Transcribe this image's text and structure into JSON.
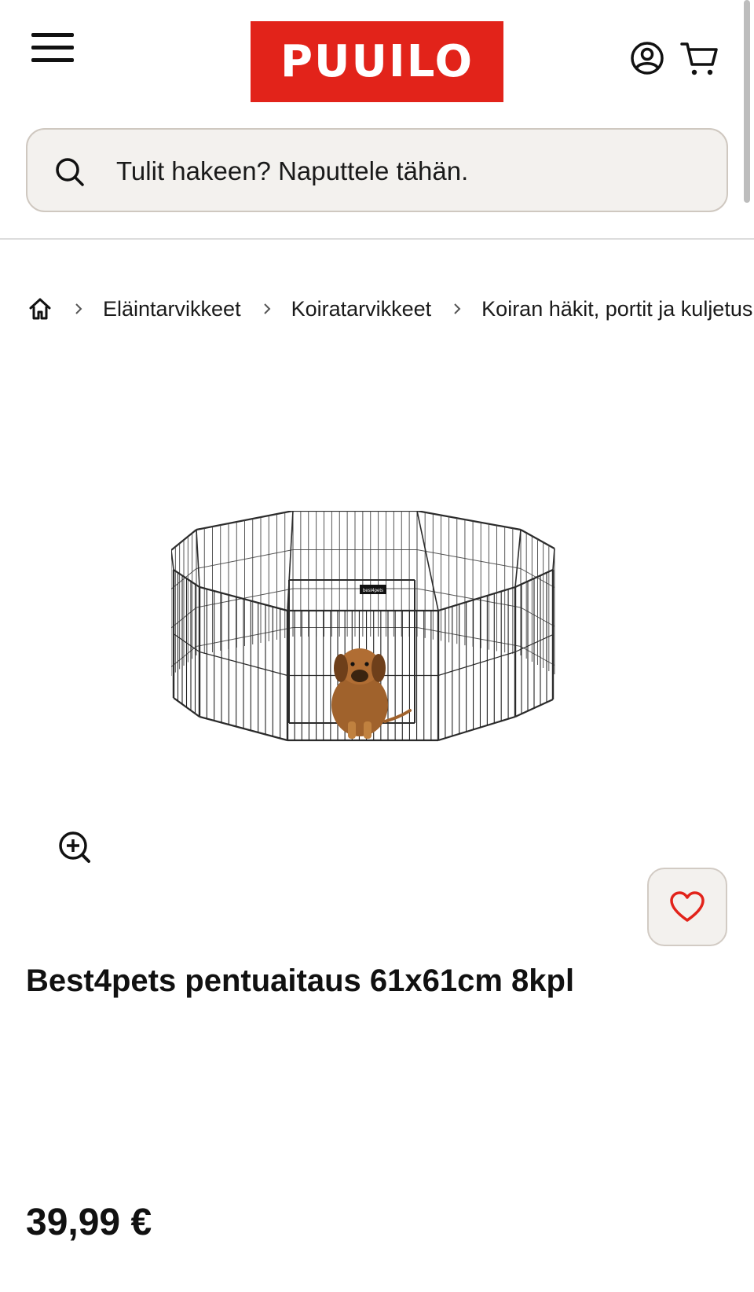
{
  "header": {
    "logo_text": "PUUILO",
    "brand_color": "#e2231a"
  },
  "search": {
    "placeholder": "Tulit hakeen? Naputtele tähän."
  },
  "breadcrumb": {
    "items": [
      "Eläintarvikkeet",
      "Koiratarvikkeet",
      "Koiran häkit, portit ja kuljetus"
    ]
  },
  "product": {
    "title": "Best4pets pentuaitaus 61x61cm 8kpl",
    "price": "39,99 €",
    "image_label": "best4pets"
  },
  "icons": {
    "menu": "hamburger-icon",
    "account": "user-icon",
    "cart": "cart-icon",
    "search": "search-icon",
    "home": "home-icon",
    "zoom": "zoom-in-icon",
    "favorite": "heart-icon"
  }
}
